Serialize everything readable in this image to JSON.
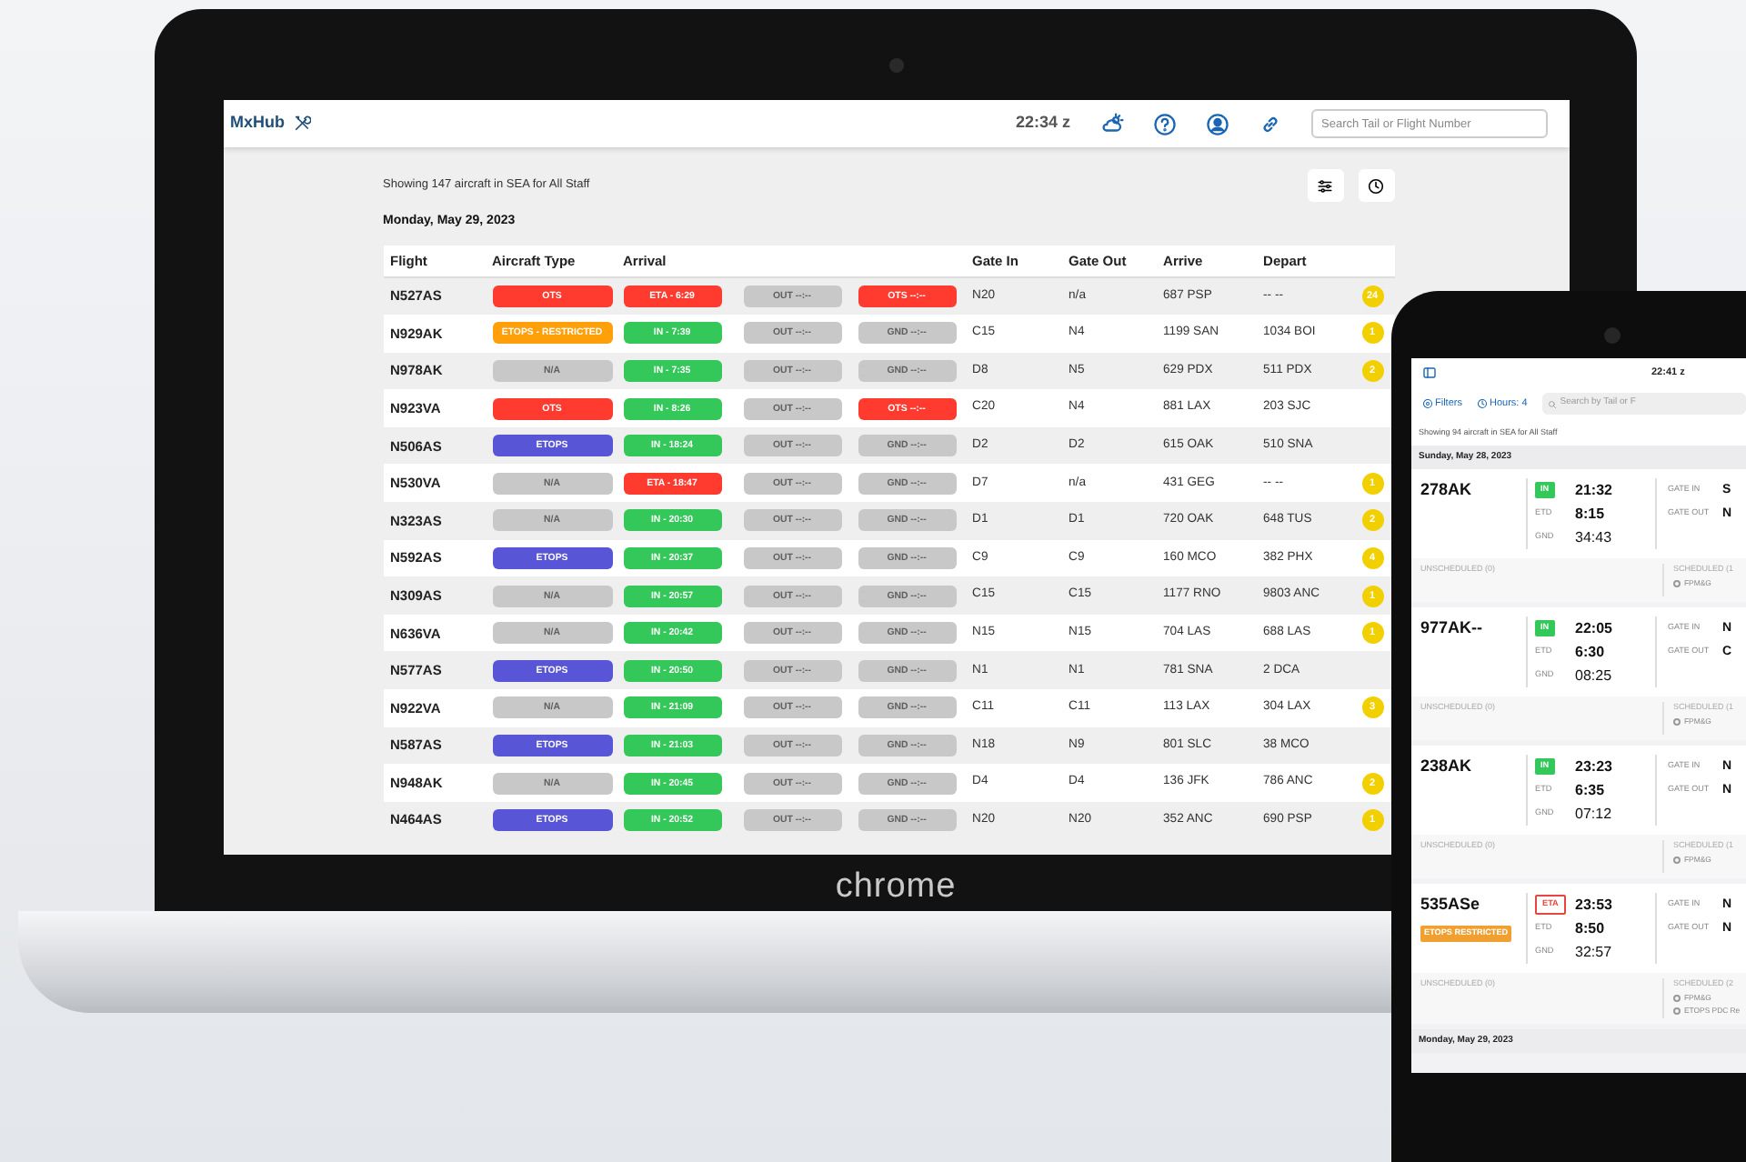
{
  "laptop": {
    "bezel_label": "chrome",
    "header": {
      "brand": "MxHub",
      "time": "22:34 z",
      "search_placeholder": "Search Tail or Flight Number"
    },
    "summary": "Showing 147 aircraft in SEA for All Staff",
    "date": "Monday, May 29, 2023",
    "table": {
      "columns": [
        {
          "label": "Flight",
          "kind": "text"
        },
        {
          "label": "Aircraft Type",
          "kind": "pill"
        },
        {
          "label": "Arrival",
          "kind": "pill-group"
        },
        {
          "label": "Gate In",
          "kind": "text"
        },
        {
          "label": "Gate Out",
          "kind": "text"
        },
        {
          "label": "Arrive",
          "kind": "text"
        },
        {
          "label": "Depart",
          "kind": "text"
        }
      ],
      "rows": [
        {
          "flight": "N527AS",
          "aircraft_type": {
            "label": "OTS",
            "color": "#ff3b30"
          },
          "arrival": {
            "label": "ETA - 6:29",
            "color": "#ff3b30"
          },
          "out": {
            "label": "OUT --:--",
            "color": "#c8c8c8"
          },
          "ground": {
            "label": "OTS --:--",
            "color": "#ff3b30"
          },
          "gate_in": "N20",
          "gate_out": "n/a",
          "arrive": "687 PSP",
          "depart": "-- --",
          "alerts": "24"
        },
        {
          "flight": "N929AK",
          "aircraft_type": {
            "label": "ETOPS - RESTRICTED",
            "color": "#ff9f0a"
          },
          "arrival": {
            "label": "IN - 7:39",
            "color": "#34c759"
          },
          "out": {
            "label": "OUT --:--",
            "color": "#c8c8c8"
          },
          "ground": {
            "label": "GND --:--",
            "color": "#c8c8c8"
          },
          "gate_in": "C15",
          "gate_out": "N4",
          "arrive": "1199 SAN",
          "depart": "1034 BOI",
          "alerts": "1"
        },
        {
          "flight": "N978AK",
          "aircraft_type": {
            "label": "N/A",
            "color": "#c8c8c8"
          },
          "arrival": {
            "label": "IN - 7:35",
            "color": "#34c759"
          },
          "out": {
            "label": "OUT --:--",
            "color": "#c8c8c8"
          },
          "ground": {
            "label": "GND --:--",
            "color": "#c8c8c8"
          },
          "gate_in": "D8",
          "gate_out": "N5",
          "arrive": "629 PDX",
          "depart": "511 PDX",
          "alerts": "2"
        },
        {
          "flight": "N923VA",
          "aircraft_type": {
            "label": "OTS",
            "color": "#ff3b30"
          },
          "arrival": {
            "label": "IN - 8:26",
            "color": "#34c759"
          },
          "out": {
            "label": "OUT --:--",
            "color": "#c8c8c8"
          },
          "ground": {
            "label": "OTS --:--",
            "color": "#ff3b30"
          },
          "gate_in": "C20",
          "gate_out": "N4",
          "arrive": "881 LAX",
          "depart": "203 SJC"
        },
        {
          "flight": "N506AS",
          "aircraft_type": {
            "label": "ETOPS",
            "color": "#5856d6"
          },
          "arrival": {
            "label": "IN - 18:24",
            "color": "#34c759"
          },
          "out": {
            "label": "OUT --:--",
            "color": "#c8c8c8"
          },
          "ground": {
            "label": "GND --:--",
            "color": "#c8c8c8"
          },
          "gate_in": "D2",
          "gate_out": "D2",
          "arrive": "615 OAK",
          "depart": "510 SNA"
        },
        {
          "flight": "N530VA",
          "aircraft_type": {
            "label": "N/A",
            "color": "#c8c8c8"
          },
          "arrival": {
            "label": "ETA - 18:47",
            "color": "#ff3b30"
          },
          "out": {
            "label": "OUT --:--",
            "color": "#c8c8c8"
          },
          "ground": {
            "label": "GND --:--",
            "color": "#c8c8c8"
          },
          "gate_in": "D7",
          "gate_out": "n/a",
          "arrive": "431 GEG",
          "depart": "-- --",
          "alerts": "1"
        },
        {
          "flight": "N323AS",
          "aircraft_type": {
            "label": "N/A",
            "color": "#c8c8c8"
          },
          "arrival": {
            "label": "IN - 20:30",
            "color": "#34c759"
          },
          "out": {
            "label": "OUT --:--",
            "color": "#c8c8c8"
          },
          "ground": {
            "label": "GND --:--",
            "color": "#c8c8c8"
          },
          "gate_in": "D1",
          "gate_out": "D1",
          "arrive": "720 OAK",
          "depart": "648 TUS",
          "alerts": "2"
        },
        {
          "flight": "N592AS",
          "aircraft_type": {
            "label": "ETOPS",
            "color": "#5856d6"
          },
          "arrival": {
            "label": "IN - 20:37",
            "color": "#34c759"
          },
          "out": {
            "label": "OUT --:--",
            "color": "#c8c8c8"
          },
          "ground": {
            "label": "GND --:--",
            "color": "#c8c8c8"
          },
          "gate_in": "C9",
          "gate_out": "C9",
          "arrive": "160 MCO",
          "depart": "382 PHX",
          "alerts": "4"
        },
        {
          "flight": "N309AS",
          "aircraft_type": {
            "label": "N/A",
            "color": "#c8c8c8"
          },
          "arrival": {
            "label": "IN - 20:57",
            "color": "#34c759"
          },
          "out": {
            "label": "OUT --:--",
            "color": "#c8c8c8"
          },
          "ground": {
            "label": "GND --:--",
            "color": "#c8c8c8"
          },
          "gate_in": "C15",
          "gate_out": "C15",
          "arrive": "1177 RNO",
          "depart": "9803 ANC",
          "alerts": "1"
        },
        {
          "flight": "N636VA",
          "aircraft_type": {
            "label": "N/A",
            "color": "#c8c8c8"
          },
          "arrival": {
            "label": "IN - 20:42",
            "color": "#34c759"
          },
          "out": {
            "label": "OUT --:--",
            "color": "#c8c8c8"
          },
          "ground": {
            "label": "GND --:--",
            "color": "#c8c8c8"
          },
          "gate_in": "N15",
          "gate_out": "N15",
          "arrive": "704 LAS",
          "depart": "688 LAS",
          "alerts": "1"
        },
        {
          "flight": "N577AS",
          "aircraft_type": {
            "label": "ETOPS",
            "color": "#5856d6"
          },
          "arrival": {
            "label": "IN - 20:50",
            "color": "#34c759"
          },
          "out": {
            "label": "OUT --:--",
            "color": "#c8c8c8"
          },
          "ground": {
            "label": "GND --:--",
            "color": "#c8c8c8"
          },
          "gate_in": "N1",
          "gate_out": "N1",
          "arrive": "781 SNA",
          "depart": "2 DCA"
        },
        {
          "flight": "N922VA",
          "aircraft_type": {
            "label": "N/A",
            "color": "#c8c8c8"
          },
          "arrival": {
            "label": "IN - 21:09",
            "color": "#34c759"
          },
          "out": {
            "label": "OUT --:--",
            "color": "#c8c8c8"
          },
          "ground": {
            "label": "GND --:--",
            "color": "#c8c8c8"
          },
          "gate_in": "C11",
          "gate_out": "C11",
          "arrive": "113 LAX",
          "depart": "304 LAX",
          "alerts": "3"
        },
        {
          "flight": "N587AS",
          "aircraft_type": {
            "label": "ETOPS",
            "color": "#5856d6"
          },
          "arrival": {
            "label": "IN - 21:03",
            "color": "#34c759"
          },
          "out": {
            "label": "OUT --:--",
            "color": "#c8c8c8"
          },
          "ground": {
            "label": "GND --:--",
            "color": "#c8c8c8"
          },
          "gate_in": "N18",
          "gate_out": "N9",
          "arrive": "801 SLC",
          "depart": "38 MCO"
        },
        {
          "flight": "N948AK",
          "aircraft_type": {
            "label": "N/A",
            "color": "#c8c8c8"
          },
          "arrival": {
            "label": "IN - 20:45",
            "color": "#34c759"
          },
          "out": {
            "label": "OUT --:--",
            "color": "#c8c8c8"
          },
          "ground": {
            "label": "GND --:--",
            "color": "#c8c8c8"
          },
          "gate_in": "D4",
          "gate_out": "D4",
          "arrive": "136 JFK",
          "depart": "786 ANC",
          "alerts": "2"
        },
        {
          "flight": "N464AS",
          "aircraft_type": {
            "label": "ETOPS",
            "color": "#5856d6"
          },
          "arrival": {
            "label": "IN - 20:52",
            "color": "#34c759"
          },
          "out": {
            "label": "OUT --:--",
            "color": "#c8c8c8"
          },
          "ground": {
            "label": "GND --:--",
            "color": "#c8c8c8"
          },
          "gate_in": "N20",
          "gate_out": "N20",
          "arrive": "352 ANC",
          "depart": "690 PSP",
          "alerts": "1"
        }
      ]
    }
  },
  "phone": {
    "time": "22:41 z",
    "filters": "Filters",
    "hours": "Hours: 4",
    "search_placeholder": "Search by Tail or F",
    "summary": "Showing 94 aircraft in SEA for All Staff",
    "sections": [
      {
        "date": "Sunday, May 28, 2023",
        "flights": [
          {
            "tail": "278AK",
            "status": {
              "label": "IN",
              "color": "#34c759",
              "outlined": false
            },
            "arrival_time": "21:32",
            "etd_label": "ETD",
            "etd": "8:15",
            "gnd_label": "GND",
            "gnd": "34:43",
            "gate_in_label": "GATE IN",
            "gate_in": "S",
            "gate_out_label": "GATE OUT",
            "gate_out": "N",
            "unscheduled": "UNSCHEDULED (0)",
            "scheduled": "SCHEDULED (1",
            "scheduled_items": [
              {
                "label": "FPM&G",
                "checked": false
              }
            ]
          },
          {
            "tail": "977AK--",
            "status": {
              "label": "IN",
              "color": "#34c759",
              "outlined": false
            },
            "arrival_time": "22:05",
            "etd_label": "ETD",
            "etd": "6:30",
            "gnd_label": "GND",
            "gnd": "08:25",
            "gate_in_label": "GATE IN",
            "gate_in": "N",
            "gate_out_label": "GATE OUT",
            "gate_out": "C",
            "unscheduled": "UNSCHEDULED (0)",
            "scheduled": "SCHEDULED (1",
            "scheduled_items": [
              {
                "label": "FPM&G",
                "checked": false
              }
            ]
          },
          {
            "tail": "238AK",
            "status": {
              "label": "IN",
              "color": "#34c759",
              "outlined": false
            },
            "arrival_time": "23:23",
            "etd_label": "ETD",
            "etd": "6:35",
            "gnd_label": "GND",
            "gnd": "07:12",
            "gate_in_label": "GATE IN",
            "gate_in": "N",
            "gate_out_label": "GATE OUT",
            "gate_out": "N",
            "unscheduled": "UNSCHEDULED (0)",
            "scheduled": "SCHEDULED (1",
            "scheduled_items": [
              {
                "label": "FPM&G",
                "checked": false
              }
            ]
          },
          {
            "tail": "535ASe",
            "tag": {
              "label": "ETOPS RESTRICTED",
              "color": "#f0a030"
            },
            "status": {
              "label": "ETA",
              "color": "#e8453c",
              "outlined": true
            },
            "arrival_time": "23:53",
            "etd_label": "ETD",
            "etd": "8:50",
            "gnd_label": "GND",
            "gnd": "32:57",
            "gate_in_label": "GATE IN",
            "gate_in": "N",
            "gate_out_label": "GATE OUT",
            "gate_out": "N",
            "unscheduled": "UNSCHEDULED (0)",
            "scheduled": "SCHEDULED (2",
            "scheduled_items": [
              {
                "label": "FPM&G",
                "checked": false
              },
              {
                "label": "ETOPS PDC Re",
                "checked": false
              }
            ]
          }
        ]
      },
      {
        "date": "Monday, May 29, 2023"
      }
    ]
  }
}
